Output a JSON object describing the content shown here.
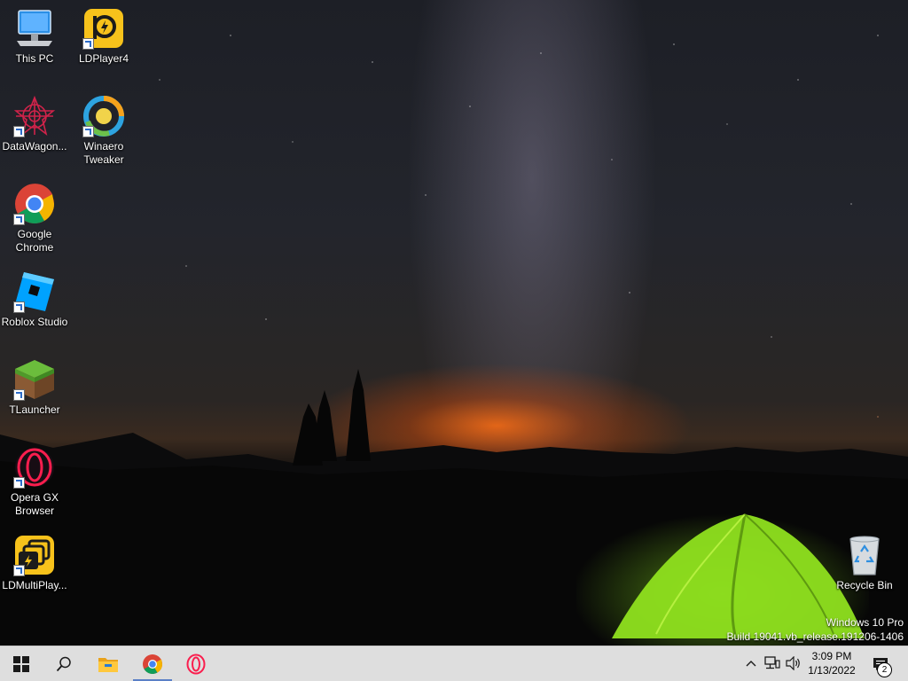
{
  "desktop": {
    "icons": [
      {
        "label": "This PC",
        "icon": "this-pc-icon"
      },
      {
        "label": "LDPlayer4",
        "icon": "ldplayer-icon"
      },
      {
        "label": "DataWagon...",
        "icon": "datawagon-icon"
      },
      {
        "label": "Winaero\nTweaker",
        "icon": "winaero-tweaker-icon"
      },
      {
        "label": "Google\nChrome",
        "icon": "chrome-icon"
      },
      {
        "label": "Roblox Studio",
        "icon": "roblox-studio-icon"
      },
      {
        "label": "TLauncher",
        "icon": "tlauncher-icon"
      },
      {
        "label": "Opera GX\nBrowser",
        "icon": "opera-gx-icon"
      },
      {
        "label": "LDMultiPlay...",
        "icon": "ldmultiplayer-icon"
      },
      {
        "label": "Recycle Bin",
        "icon": "recycle-bin-icon"
      }
    ],
    "watermark": {
      "edition": "Windows 10 Pro",
      "build": "Build 19041.vb_release.191206-1406"
    }
  },
  "taskbar": {
    "pinned": [
      "start-icon",
      "search-icon",
      "file-explorer-icon",
      "chrome-icon",
      "opera-gx-icon"
    ],
    "tray": [
      "chevron-up-icon",
      "network-icon",
      "volume-icon"
    ],
    "clock": {
      "time": "3:09 PM",
      "date": "1/13/2022"
    },
    "notifications": {
      "count": "2"
    }
  },
  "colors": {
    "taskbar_bg": "#dedede",
    "active_indicator": "#5a7fc7",
    "tent_green": "#8fe01f",
    "horizon_orange": "#ff6e14"
  }
}
